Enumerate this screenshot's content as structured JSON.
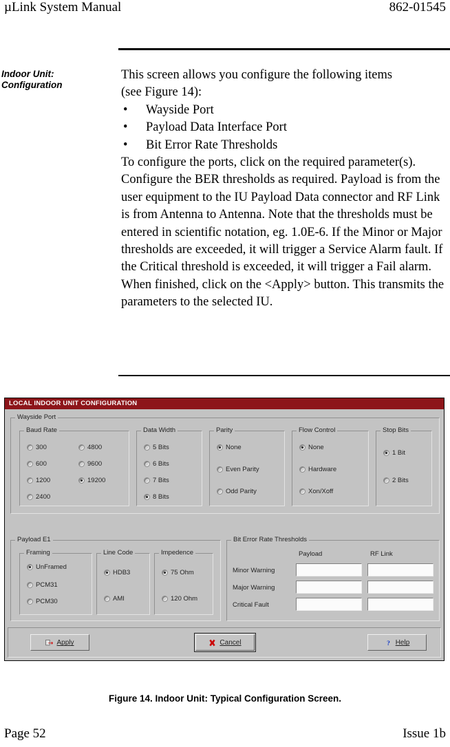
{
  "page": {
    "header_left": "µLink System Manual",
    "header_right": "862-01545",
    "footer_left": "Page 52",
    "footer_right": "Issue 1b",
    "figure_caption": "Figure 14.  Indoor Unit:  Typical Configuration Screen."
  },
  "section": {
    "side_heading_line1": "Indoor Unit:",
    "side_heading_line2": "Configuration",
    "intro_line1": "This screen allows you configure the following items",
    "intro_line2": "(see Figure 14):",
    "bullets": [
      "Wayside Port",
      "Payload Data Interface Port",
      "Bit Error Rate Thresholds"
    ],
    "bullet_glyph": "•",
    "para2": "To configure the ports, click on the required parameter(s).",
    "para3": "Configure the BER thresholds as required.  Payload is from the user equipment to the IU Payload Data connector and RF Link is from Antenna to Antenna.  Note that the thresholds must be entered in scientific notation, eg. 1.0E-6.  If the Minor or Major thresholds are exceeded, it will trigger a Service Alarm fault.  If the Critical threshold is exceeded, it will trigger a Fail alarm.",
    "para4": "When finished, click on the <Apply> button.  This transmits the parameters to the selected IU."
  },
  "dialog": {
    "title": "LOCAL INDOOR UNIT CONFIGURATION",
    "title_bar_color": "#8b0d12",
    "face_color": "#c4c4c4",
    "wayside_port": {
      "label": "Wayside Port",
      "baud_rate": {
        "label": "Baud Rate",
        "options": [
          "300",
          "600",
          "1200",
          "2400",
          "4800",
          "9600",
          "19200"
        ],
        "selected": "19200"
      },
      "data_width": {
        "label": "Data Width",
        "options": [
          "5 Bits",
          "6 Bits",
          "7 Bits",
          "8 Bits"
        ],
        "selected": "8 Bits"
      },
      "parity": {
        "label": "Parity",
        "options": [
          "None",
          "Even Parity",
          "Odd Parity"
        ],
        "selected": "None"
      },
      "flow_control": {
        "label": "Flow Control",
        "options": [
          "None",
          "Hardware",
          "Xon/Xoff"
        ],
        "selected": "None"
      },
      "stop_bits": {
        "label": "Stop Bits",
        "options": [
          "1 Bit",
          "2 Bits"
        ],
        "selected": "1 Bit"
      }
    },
    "payload_e1": {
      "label": "Payload E1",
      "framing": {
        "label": "Framing",
        "options": [
          "UnFramed",
          "PCM31",
          "PCM30"
        ],
        "selected": "UnFramed"
      },
      "line_code": {
        "label": "Line Code",
        "options": [
          "HDB3",
          "AMI"
        ],
        "selected": "HDB3"
      },
      "impedence": {
        "label": "Impedence",
        "options": [
          "75 Ohm",
          "120 Ohm"
        ],
        "selected": "75 Ohm"
      }
    },
    "ber_thresholds": {
      "label": "Bit Error Rate Thresholds",
      "columns": [
        "Payload",
        "RF Link"
      ],
      "rows": [
        {
          "label": "Minor Warning",
          "payload": "",
          "rf_link": ""
        },
        {
          "label": "Major Warning",
          "payload": "",
          "rf_link": ""
        },
        {
          "label": "Critical Fault",
          "payload": "",
          "rf_link": ""
        }
      ]
    },
    "buttons": {
      "apply": "Apply",
      "cancel": "Cancel",
      "help": "Help"
    }
  }
}
